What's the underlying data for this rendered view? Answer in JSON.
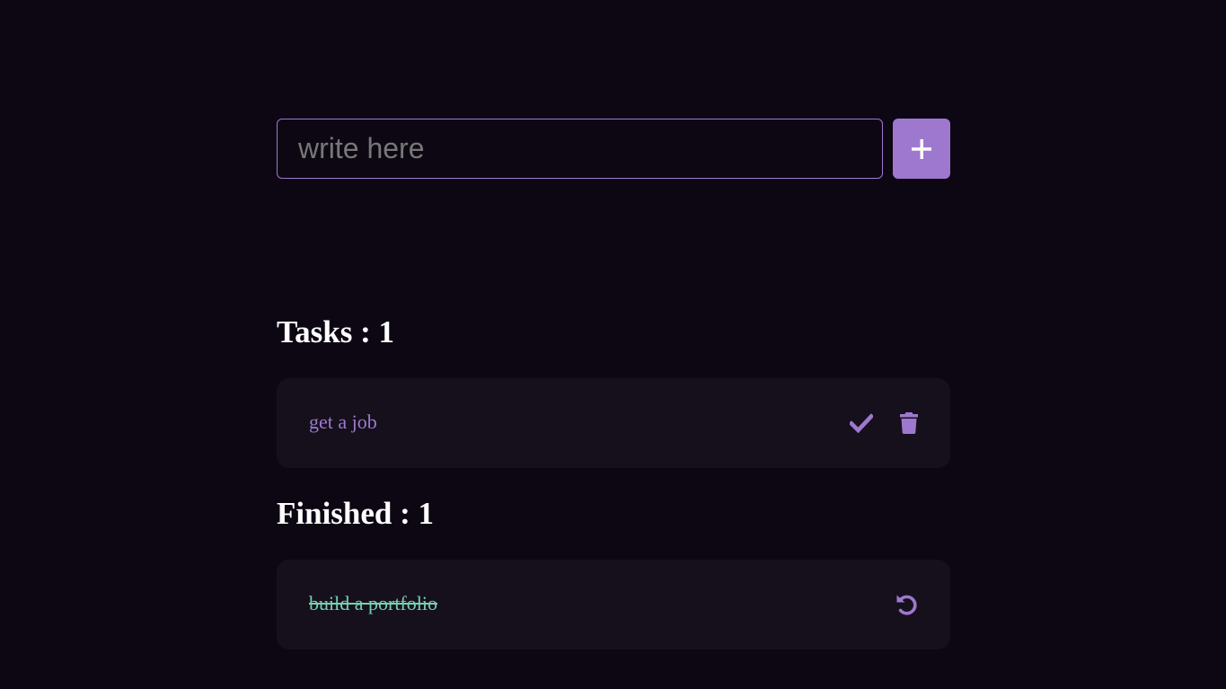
{
  "new_task": {
    "placeholder": "write here",
    "value": "",
    "add_icon": "plus-icon"
  },
  "tasks_section": {
    "label": "Tasks",
    "separator": " : ",
    "count": "1",
    "items": [
      {
        "text": "get a job",
        "actions": [
          "check-icon",
          "trash-icon"
        ]
      }
    ]
  },
  "finished_section": {
    "label": "Finished",
    "separator": " : ",
    "count": "1",
    "items": [
      {
        "text": "build a portfolio",
        "actions": [
          "undo-icon"
        ]
      }
    ]
  },
  "colors": {
    "background": "#0d0714",
    "card": "#15101c",
    "accent": "#9e78cf",
    "done": "#78cfb0",
    "heading": "#ffffff"
  }
}
